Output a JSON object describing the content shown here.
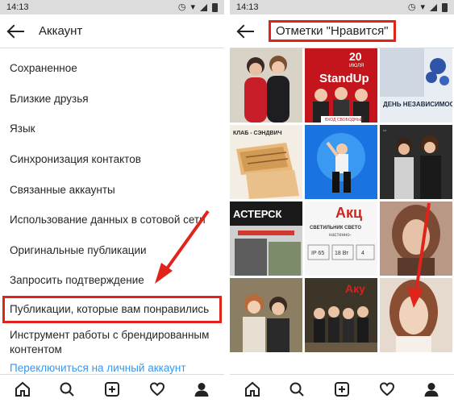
{
  "left": {
    "status": {
      "time": "14:13"
    },
    "header": {
      "title": "Аккаунт"
    },
    "menu": [
      "Сохраненное",
      "Близкие друзья",
      "Язык",
      "Синхронизация контактов",
      "Связанные аккаунты",
      "Использование данных в сотовой сети",
      "Оригинальные публикации",
      "Запросить подтверждение",
      "Публикации, которые вам понравились",
      "Инструмент работы с брендированным контентом",
      "Переключиться на личный аккаунт"
    ]
  },
  "right": {
    "status": {
      "time": "14:13"
    },
    "header": {
      "title": "Отметки \"Нравится\""
    },
    "thumbs": {
      "t2_title": "StandUp",
      "t2_date_num": "20",
      "t2_date_month": "ИЮЛЯ",
      "t2_sub": "ВХОД СВОБОДНЫЙ",
      "t3_title": "ДЕНЬ НЕЗАВИСИМОСТИ",
      "t4_title": "КЛАБ - СЭНДВИЧ",
      "t7_title": "АСТЕРСК",
      "t8_title": "Акц",
      "t8_sub1": "СВЕТИЛЬНИК СВЕТО",
      "t8_sub2": "настенно-",
      "t8_spec1": "IP 65",
      "t8_spec2": "18 Вт",
      "t8_spec3": "4",
      "t11_title": "Аку"
    }
  },
  "colors": {
    "highlight_red": "#e0241a",
    "link_blue": "#3897f0",
    "statusbar_gray": "#dcdcdc"
  }
}
